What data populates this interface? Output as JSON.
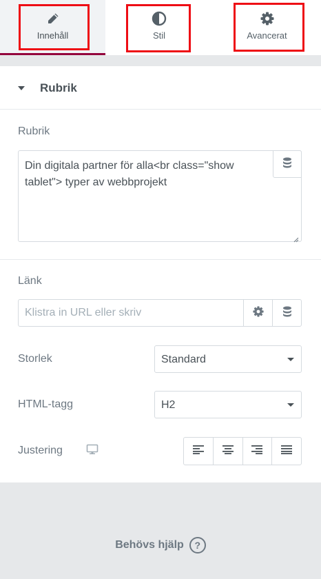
{
  "tabs": [
    {
      "label": "Innehåll",
      "icon": "pencil-icon",
      "active": true
    },
    {
      "label": "Stil",
      "icon": "half-circle-icon",
      "active": false
    },
    {
      "label": "Avancerat",
      "icon": "gear-icon",
      "active": false
    }
  ],
  "section": {
    "title": "Rubrik",
    "expanded": true
  },
  "heading_control": {
    "label": "Rubrik",
    "value": "Din digitala partner för alla<br class=\"show\ntablet\"> typer av webbprojekt",
    "dynamic_icon": "database-icon"
  },
  "link_control": {
    "label": "Länk",
    "placeholder": "Klistra in URL eller skriv",
    "settings_icon": "gear-icon",
    "dynamic_icon": "database-icon"
  },
  "size_control": {
    "label": "Storlek",
    "selected": "Standard"
  },
  "tag_control": {
    "label": "HTML-tagg",
    "selected": "H2"
  },
  "alignment_control": {
    "label": "Justering",
    "responsive_icon": "desktop-icon",
    "options": [
      "align-left-icon",
      "align-center-icon",
      "align-right-icon",
      "align-justify-icon"
    ]
  },
  "footer": {
    "help_text": "Behövs hjälp",
    "help_icon": "question-circle-icon"
  },
  "colors": {
    "accent": "#93003c",
    "highlight": "#ee0c14",
    "text": "#495157",
    "muted": "#6d7882",
    "border": "#d5dadf"
  }
}
